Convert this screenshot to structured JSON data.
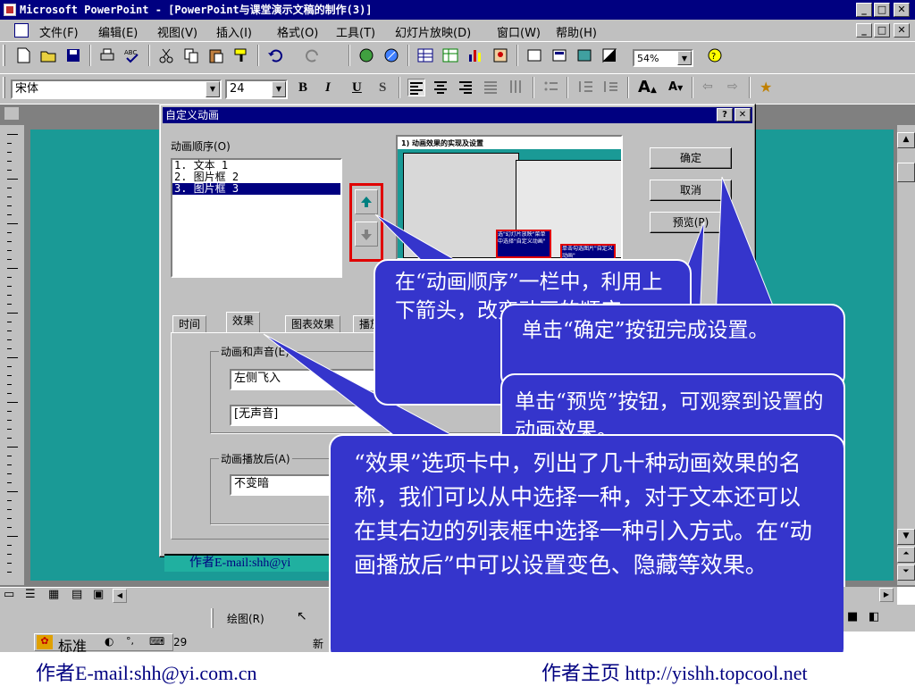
{
  "window": {
    "title": "Microsoft PowerPoint - [PowerPoint与课堂演示文稿的制作(3)]",
    "min": "_",
    "max": "□",
    "close": "✕"
  },
  "menu": {
    "items": [
      "文件(F)",
      "编辑(E)",
      "视图(V)",
      "插入(I)",
      "格式(O)",
      "工具(T)",
      "幻灯片放映(D)",
      "窗口(W)",
      "帮助(H)"
    ]
  },
  "toolbar": {
    "zoom": "54%",
    "font": "宋体",
    "size": "24",
    "bold": "B",
    "italic": "I",
    "underline": "U",
    "shadow": "S"
  },
  "dialog": {
    "title": "自定义动画",
    "help": "?",
    "order_label": "动画顺序(O)",
    "order_items": [
      "1. 文本 1",
      "2. 图片框 2",
      "3. 图片框 3"
    ],
    "preview_title": "1) 动画效果的实现及设置",
    "preview_note1": "选\"幻灯片放映\"菜单中选择\"自定义动画\"",
    "preview_note2": "单击勾选图片\"自定义动画\"",
    "ok": "确定",
    "cancel": "取消",
    "preview": "预览(P)",
    "tabs": [
      "时间",
      "效果",
      "图表效果",
      "播放设置"
    ],
    "group_sound": "动画和声音(E)",
    "effect_value": "左侧飞入",
    "sound_value": "[无声音]",
    "group_after": "动画播放后(A)",
    "after_value": "不变暗",
    "author_strip": "作者E-mail:shh@yi"
  },
  "callouts": {
    "order": "在“动画顺序”一栏中，利用上下箭头，改变动画的顺序。",
    "ok": "单击“确定”按钮完成设置。",
    "preview": "单击“预览”按钮，可观察到设置的动画效果。",
    "effects": "“效果”选项卡中，列出了几十种动画效果的名称，我们可以从中选择一种，对于文本还可以在其右边的列表框中选择一种引入方式。在“动画播放后”中可以设置变色、隐藏等效果。"
  },
  "drawing": {
    "label": "绘图(R)",
    "ime": "标准"
  },
  "status": {
    "slide_num": "29",
    "partial": "新"
  },
  "footer": {
    "email": "作者E-mail:shh@yi.com.cn",
    "homepage": "作者主页 http://yishh.topcool.net"
  },
  "colors": {
    "titlebar": "#000080",
    "callout": "#3535cc",
    "slide": "#1a9a96",
    "arrow_highlight": "#e00000"
  }
}
